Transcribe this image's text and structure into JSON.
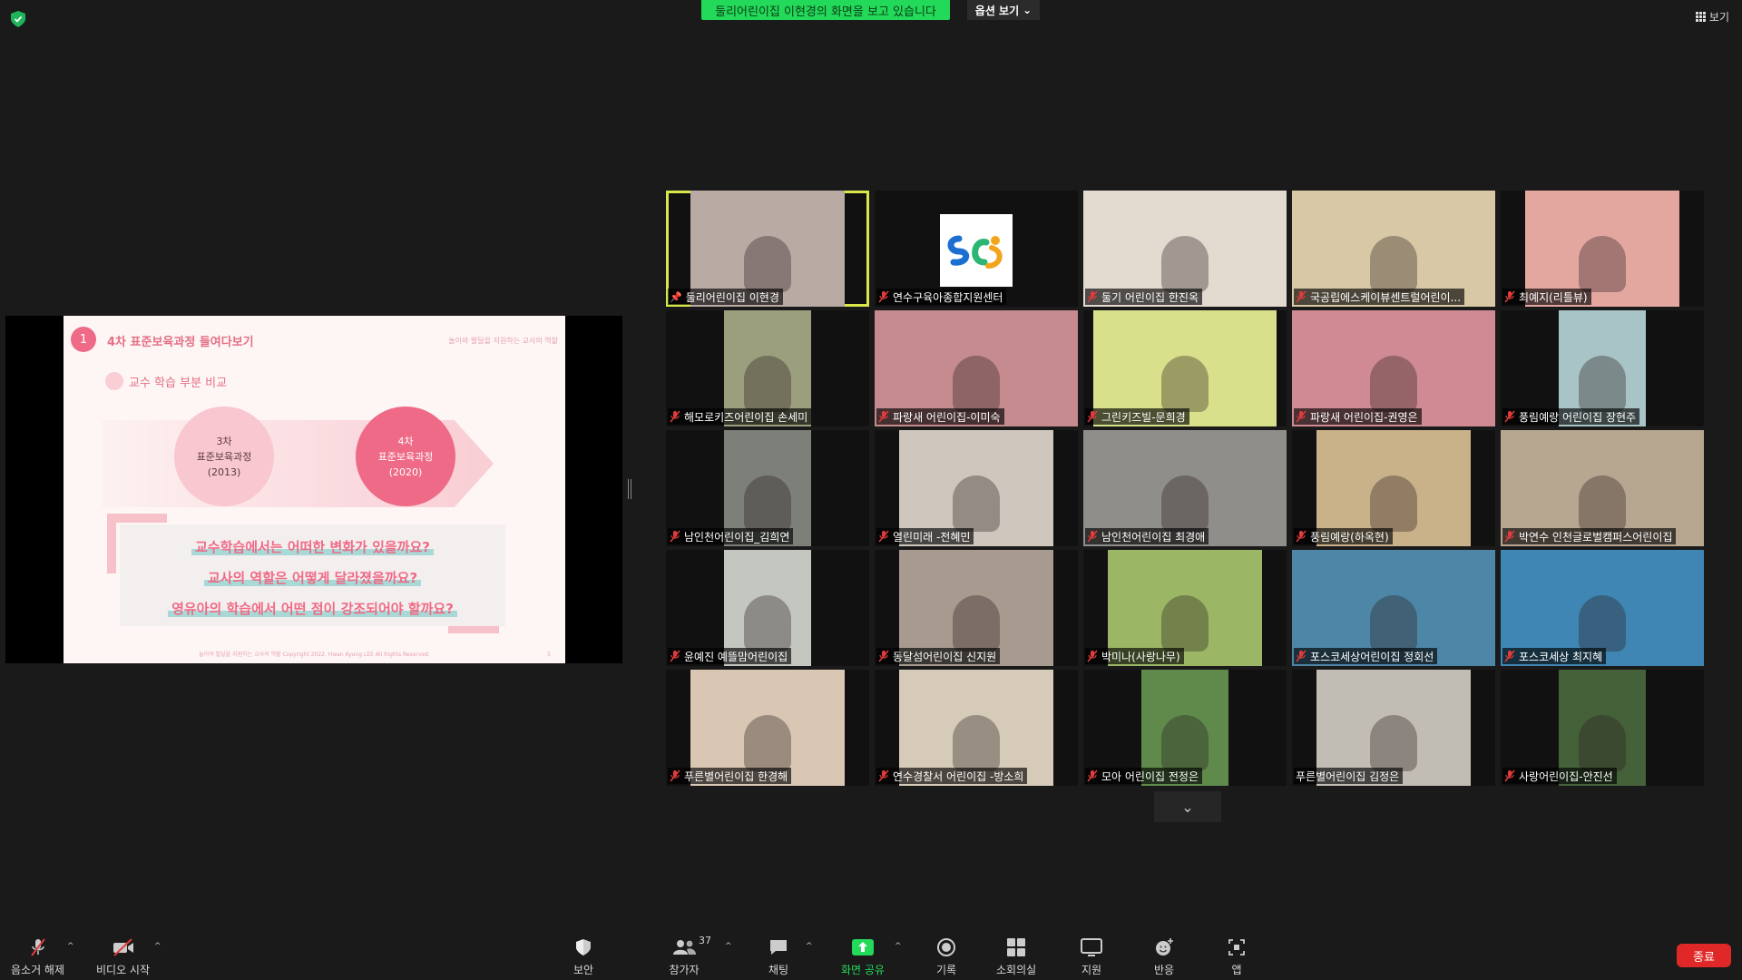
{
  "top": {
    "share_banner": "둘리어린이집 이현경의 화면을 보고 있습니다",
    "view_options": "옵션 보기",
    "view": "보기"
  },
  "slide": {
    "number": "1",
    "title": "4차 표준보육과정 들여다보기",
    "subheading": "놀이와 발달을 지원하는 교사의 역할",
    "section": "교수 학습 부분 비교",
    "circle_a": [
      "3차",
      "표준보육과정",
      "(2013)"
    ],
    "circle_b": [
      "4차",
      "표준보육과정",
      "(2020)"
    ],
    "questions": [
      "교수학습에서는 어떠한 변화가 있을까요?",
      "교사의 역할은 어떻게 달라졌을까요?",
      "영유아의 학습에서 어떤 점이 강조되어야 할까요?"
    ],
    "footer": "놀이와 발달을 지원하는 교사의 역할 Copyright 2022. Hwan Kyung LEE All Rights Reserved.",
    "page": "5"
  },
  "participants": [
    {
      "name": "둘리어린이집 이현경",
      "active": true,
      "pinned": true,
      "bg": "#b9aaa4"
    },
    {
      "name": "연수구육아종합지원센터",
      "logo": true,
      "bg": "#ffffff"
    },
    {
      "name": "둘기 어린이집 한진옥",
      "bg": "#e3dbd0"
    },
    {
      "name": "국공립에스케이뷰센트럴어린이...",
      "bg": "#d9c8a6"
    },
    {
      "name": "최예지(리틀뷰)",
      "bg": "#e4a7a0"
    },
    {
      "name": "해모로키즈어린이집 손세미",
      "bg": "#9c9f7d"
    },
    {
      "name": "파랑새 어린이집-이미숙",
      "bg": "#c58b8e"
    },
    {
      "name": "그린키즈빌-문희경",
      "bg": "#d8e08b"
    },
    {
      "name": "파랑새 어린이집-권영은",
      "bg": "#cf8a93"
    },
    {
      "name": "풍림예랑 어린이집 장현주",
      "bg": "#a9c4c6"
    },
    {
      "name": "남인천어린이집_김희연",
      "bg": "#7d8078"
    },
    {
      "name": "열린미래 -전혜민",
      "bg": "#cfc7bd"
    },
    {
      "name": "남인천어린이집 최경애",
      "bg": "#8f8e8b"
    },
    {
      "name": "풍림예랑(하옥현)",
      "bg": "#c9b18a"
    },
    {
      "name": "박연수 인천글로벌캠퍼스어린이집",
      "bg": "#b7a791"
    },
    {
      "name": "윤예진 예뜰맘어린이집",
      "bg": "#c4c7c0"
    },
    {
      "name": "동달섬어린이집 신지원",
      "bg": "#a79a8e"
    },
    {
      "name": "박미나(사랑나무)",
      "bg": "#9bb765"
    },
    {
      "name": "포스코세상어린이집 정회선",
      "bg": "#4d86a7"
    },
    {
      "name": "포스코세상 최지혜",
      "bg": "#3f86b4"
    },
    {
      "name": "푸른별어린이집 한경해",
      "bg": "#d9c7b4"
    },
    {
      "name": "연수경찰서 어린이집 -방소희",
      "bg": "#d6cbb8"
    },
    {
      "name": "모아 어린이집 전정은",
      "bg": "#5f8a4c"
    },
    {
      "name": "푸른별어린이집 김정은",
      "bg": "#c2bdb4",
      "no_mic_icon": true
    },
    {
      "name": "사랑어린이집-안진선",
      "bg": "#44613a"
    }
  ],
  "toolbar": {
    "unmute": "음소거 해제",
    "start_video": "비디오 시작",
    "security": "보안",
    "participants": "참가자",
    "participant_count": "37",
    "chat": "채팅",
    "share_screen": "화면 공유",
    "record": "기록",
    "breakout": "소회의실",
    "support": "지원",
    "reactions": "반응",
    "apps": "앱",
    "end": "종료"
  },
  "colors": {
    "share_green": "#23d959",
    "active_speaker": "#d8e84a",
    "end_red": "#e02828",
    "mic_off_red": "#e03c3c"
  }
}
